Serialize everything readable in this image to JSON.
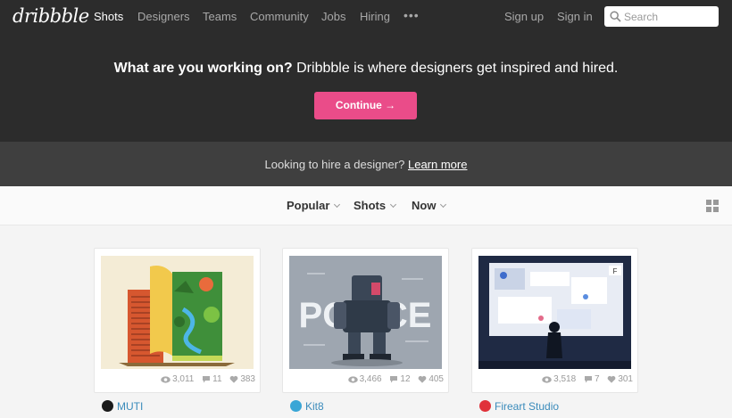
{
  "nav": {
    "logo": "dribbble",
    "links": [
      "Shots",
      "Designers",
      "Teams",
      "Community",
      "Jobs",
      "Hiring"
    ],
    "more": "•••",
    "signup": "Sign up",
    "signin": "Sign in",
    "search_placeholder": "Search"
  },
  "hero": {
    "question": "What are you working on?",
    "tagline": "Dribbble is where designers get inspired and hired.",
    "cta": "Continue →",
    "hire_text": "Looking to hire a designer?",
    "hire_link": "Learn more"
  },
  "filters": [
    "Popular",
    "Shots",
    "Now"
  ],
  "shots": [
    {
      "views": "3,011",
      "comments": "11",
      "likes": "383",
      "author": "MUTI",
      "avatar_color": "#1a1a1a"
    },
    {
      "views": "3,466",
      "comments": "12",
      "likes": "405",
      "author": "Kit8",
      "avatar_color": "#3aa6d6"
    },
    {
      "views": "3,518",
      "comments": "7",
      "likes": "301",
      "author": "Fireart Studio",
      "avatar_color": "#e0323a"
    }
  ],
  "shot_art": {
    "police_word": "POLICE",
    "badge": "F"
  },
  "colors": {
    "brand_pink": "#ea4c89",
    "dark_bg": "#2c2c2c",
    "link_blue": "#3a8bbb"
  }
}
